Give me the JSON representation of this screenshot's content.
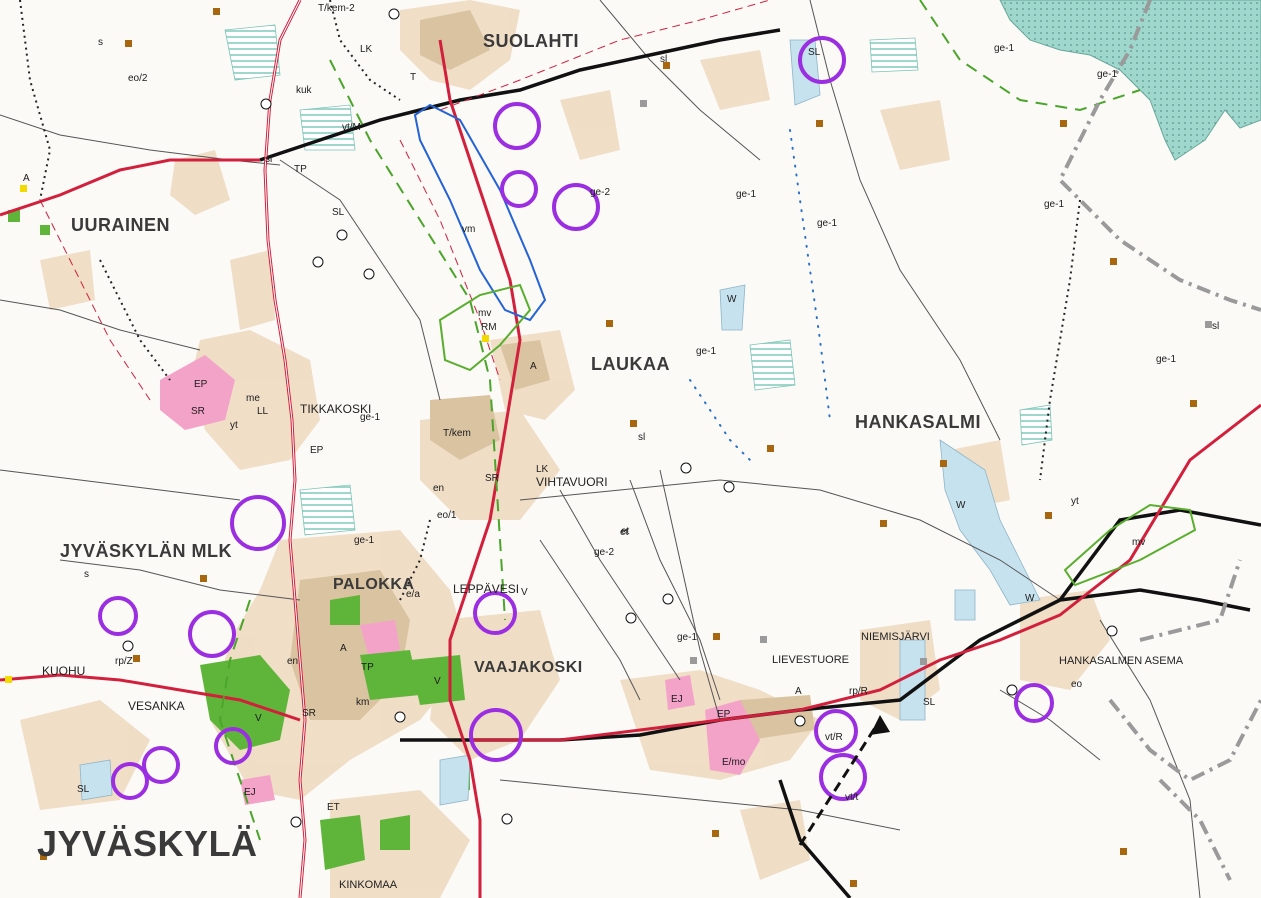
{
  "map": {
    "colors": {
      "background": "#fbfaf7",
      "settlement": "#efdcc4",
      "settlement_dark": "#d9c3a1",
      "green_area": "#5fb53a",
      "pink_area": "#f4a3c8",
      "protected_teal": "#9fd7cc",
      "lake_blue": "#c6e2ee",
      "main_road": "#d21f3c",
      "railway": "#111111",
      "purple_circle": "#9a2ee0",
      "blue_outline": "#2463d6",
      "green_outline": "#5aae2e",
      "green_dash": "#4aa52a",
      "grey_border": "#9a9a9a"
    },
    "place_names": [
      "SUOLAHTI",
      "UURAINEN",
      "LAUKAA",
      "HANKASALMI",
      "TIKKAKOSKI",
      "VIHTAVUORI",
      "JYVÄSKYLÄN MLK",
      "PALOKKA",
      "LEPPÄVESI",
      "VAAJAKOSKI",
      "KUOHU",
      "VESANKA",
      "JYVÄSKYLÄ",
      "KINKOMAA",
      "NIEMISJÄRVI",
      "LIEVESTUORE",
      "HANKASALMEN ASEMA"
    ],
    "codes": [
      "T/kem-2",
      "LK",
      "T",
      "sl",
      "s",
      "eo/2",
      "kuk",
      "TP",
      "A",
      "ge-1",
      "SL",
      "ge-2",
      "vm",
      "mv",
      "RM",
      "EP",
      "SR",
      "me",
      "LL",
      "T/kem",
      "en",
      "eo/1",
      "et",
      "W",
      "e/a",
      "V",
      "km",
      "rp/Z",
      "EJ",
      "ET",
      "E/mo",
      "vt/R",
      "eo",
      "yt",
      "rp/R",
      "vt/t",
      "vt/M"
    ],
    "icons": [
      "purple-circle-icon",
      "number-marker-icon",
      "settlement-square-icon"
    ]
  }
}
